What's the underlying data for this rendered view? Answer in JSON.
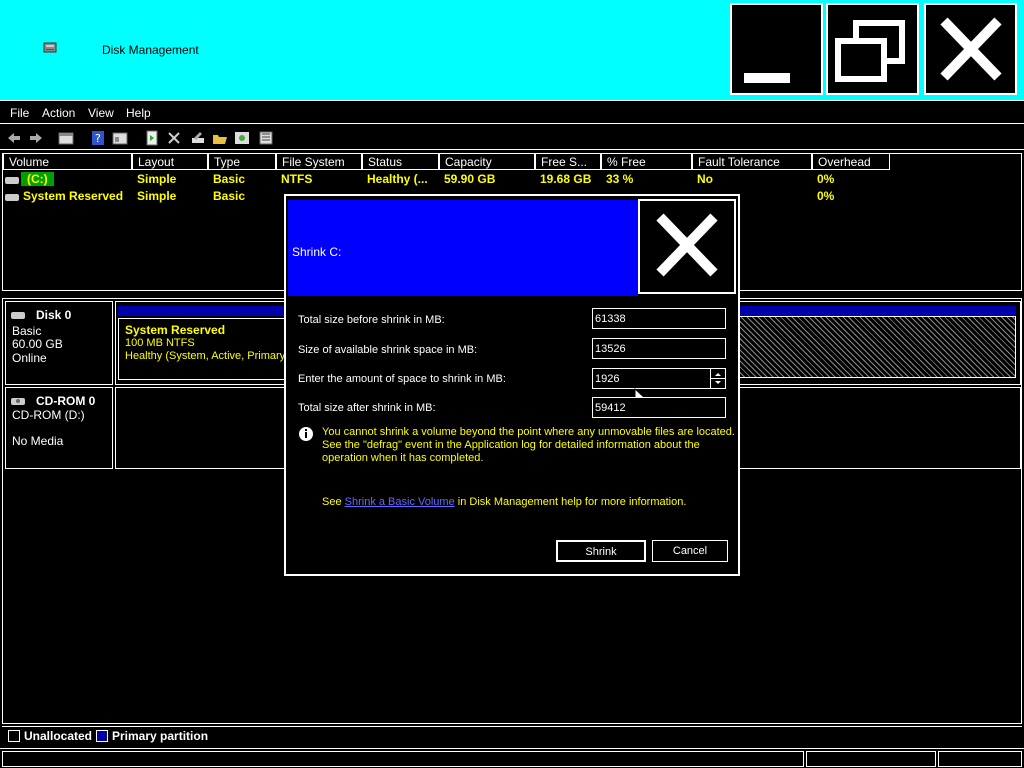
{
  "window": {
    "title": "Disk Management"
  },
  "menu": [
    "File",
    "Action",
    "View",
    "Help"
  ],
  "toolbar_icons": [
    "back-icon",
    "forward-icon",
    "console-tree-icon",
    "help-icon",
    "properties-icon",
    "refresh-icon",
    "delete-icon",
    "settings-icon",
    "open-icon",
    "search-icon",
    "rescan-icon"
  ],
  "volume_table": {
    "headers": [
      "Volume",
      "Layout",
      "Type",
      "File System",
      "Status",
      "Capacity",
      "Free S...",
      "% Free",
      "Fault Tolerance",
      "Overhead"
    ],
    "rows": [
      {
        "volume": "(C:)",
        "layout": "Simple",
        "type": "Basic",
        "fs": "NTFS",
        "status": "Healthy (...",
        "capacity": "59.90 GB",
        "free": "19.68 GB",
        "pct": "33 %",
        "fault": "No",
        "overhead": "0%"
      },
      {
        "volume": "System Reserved",
        "layout": "Simple",
        "type": "Basic",
        "fs": "",
        "status": "",
        "capacity": "",
        "free": "",
        "pct": "",
        "fault": "",
        "overhead": "0%"
      }
    ]
  },
  "disks": [
    {
      "name": "Disk 0",
      "type": "Basic",
      "size": "60.00 GB",
      "state": "Online",
      "partition": {
        "name": "System Reserved",
        "size": "100 MB NTFS",
        "status": "Healthy (System, Active, Primary P"
      }
    },
    {
      "name": "CD-ROM 0",
      "type": "CD-ROM (D:)",
      "size": "",
      "state": "No Media"
    }
  ],
  "legend": [
    "Unallocated",
    "Primary partition"
  ],
  "colors": {
    "titlebar": "#00ffff",
    "dialog_title": "#0000ff",
    "primary": "#0000aa",
    "highlight": "#ffff00",
    "selected": "#00a000"
  },
  "dialog": {
    "title": "Shrink C:",
    "labels": {
      "before": "Total size before shrink in MB:",
      "available": "Size of available shrink space in MB:",
      "amount": "Enter the amount of space to shrink in MB:",
      "after": "Total size after shrink in MB:"
    },
    "values": {
      "before": "61338",
      "available": "13526",
      "amount": "1926",
      "after": "59412"
    },
    "info_line1": "You cannot shrink a volume beyond the point where any unmovable files are located.",
    "info_line2": "See the \"defrag\" event in the Application log for detailed information about the",
    "info_line3": "operation when it has completed.",
    "help_prefix": "See ",
    "help_link": "Shrink a Basic Volume",
    "help_suffix": " in Disk Management help for more information.",
    "shrink_label": "Shrink",
    "cancel_label": "Cancel"
  }
}
